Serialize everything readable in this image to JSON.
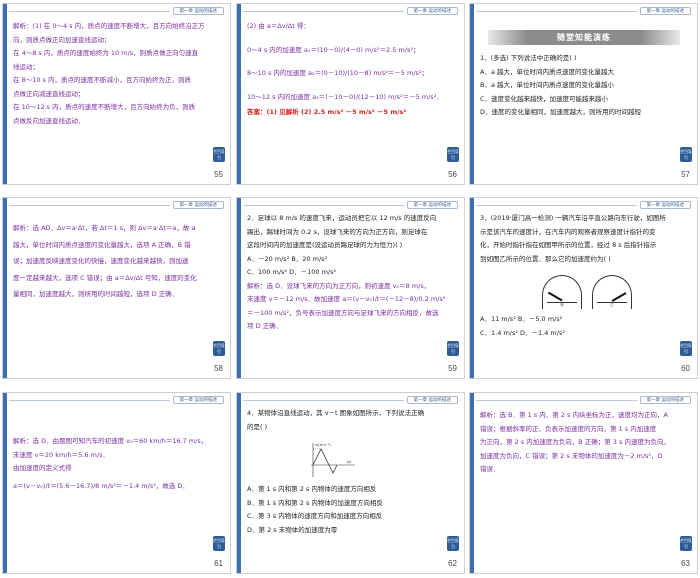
{
  "header_label": "第一章  运动的描述",
  "back_label": "栏目导引",
  "slides": [
    {
      "page": "55",
      "lines": [
        "解析：(1) 在 0～4 s 内，质点的速度不断增大，且方向始终沿正方",
        "向，则质点做正向加速直线运动；",
        "在 4～8 s 内，质点的速度始终为 10 m/s，则质点做正向匀速直",
        "线运动；",
        "在 8～10 s 内，质点的速度不断减小，且方向始终为正，则质",
        "点做正向减速直线运动；",
        "在 10～12 s 内，质点的速度不断增大，且方向始终为负，则质",
        "点做反向加速直线运动．"
      ]
    },
    {
      "page": "56",
      "lines": [
        "(2) 由 a＝Δv/Δt 得：",
        "0～4 s 内的加速度 a₁＝(10－0)/(4－0) m/s²＝2.5 m/s²；",
        "8～10 s 内的加速度 a₂＝(0－10)/(10－8) m/s²＝－5 m/s²；",
        "10～12 s 内的加速度 a₃＝(－10－0)/(12－10) m/s²＝－5 m/s²．",
        "答案：(1) 见解析  (2) 2.5 m/s²   －5 m/s²   －5 m/s²"
      ]
    },
    {
      "page": "57",
      "banner": "随堂知能演练",
      "lines": [
        "1．(多选) 下列说法中正确的是(    )",
        "A．a 越大，单位时间内质点速度的变化量越大",
        "B．a 越大，单位时间内质点速度的变化量越小",
        "C．速度变化越来越快，加速度可能越来越小",
        "D．速度的变化量相同，加速度越大，则所用的时间越短"
      ]
    },
    {
      "page": "58",
      "lines": [
        "解析：选 AD．Δv＝a·Δt，若 Δt＝1 s，则 Δv＝a·Δt＝a，故 a",
        "越大，单位时间内质点速度的变化量越大，选项 A 正确，B 错",
        "误；加速度反映速度变化的快慢，速度变化越来越快，则加速",
        "度一定越来越大，选项 C 错误；由 a＝Δv/Δt 可知，速度的变化",
        "量相同，加速度越大，则所用的时间越短，选项 D 正确．"
      ]
    },
    {
      "page": "59",
      "lines": [
        "2．足球以 8 m/s 的速度飞来，运动员把它以 12 m/s 的速度反向",
        "踢出，踢球时间为 0.2 s，设球飞来的方向为正方向，则足球在",
        "这段时间内的加速度是(设运动员踢足球的力为恒力)(    )",
        "A．－20 m/s²                 B．20 m/s²",
        "C．100 m/s²                  D．－100 m/s²",
        "解析：选 D．设球飞来的方向为正方向，则初速度 v₀＝8 m/s，",
        "末速度 v＝－12 m/s．故加速度 a＝(v－v₀)/t＝(－12－8)/0.2 m/s²",
        "＝－100 m/s²，负号表示加速度方向与足球飞来的方向相反，故选",
        "项 D 正确．"
      ]
    },
    {
      "page": "60",
      "lines": [
        "3．(2019·厦门高一检测) 一辆汽车沿平直公路向东行驶，如图所",
        "示是该汽车的速度计，在汽车内的观察者观察速度计指针的变",
        "化，开始时指针指在如图甲所示的位置，经过 8 s 后指针指示",
        "到如图乙所示的位置．那么它的加速度约为(    )"
      ],
      "gauge_labels": [
        "甲",
        "乙"
      ],
      "options": [
        "A．11 m/s²                    B．－5.0 m/s²",
        "C．1.4 m/s²                   D．－1.4 m/s²"
      ]
    },
    {
      "page": "61",
      "lines": [
        "解析：选 D．由题图可知汽车的初速度 v₀＝60 km/h＝16.7 m/s，",
        "末速度 v＝20 km/h＝5.6 m/s．",
        "由加速度的定义式得",
        "a＝(v－v₀)/t＝(5.6－16.7)/8 m/s²＝－1.4 m/s²，故选 D．"
      ]
    },
    {
      "page": "62",
      "lines": [
        "4．某物体沿直线运动，其 v－t 图象如图所示，下列说法正确",
        "的是(    )"
      ],
      "graph_labels": {
        "y": "v/(m·s⁻¹)",
        "x": "t/s"
      },
      "options": [
        "A．第 1 s 内和第 2 s 内物体的速度方向相反",
        "B．第 1 s 内和第 2 s 内物体的加速度方向相反",
        "C．第 3 s 内物体的速度方向和加速度方向相反",
        "D．第 2 s 末物体的加速度为零"
      ]
    },
    {
      "page": "63",
      "lines": [
        "解析：选 B．第 1 s 内、第 2 s 内纵坐标为正，速度均为正向，A",
        "错误；根据斜率的正、负表示加速度的方向，第 1 s 内加速度",
        "为正向，第 2 s 内加速度为负向，B 正确；第 3 s 内速度为负向，",
        "加速度为负向，C 错误；第 2 s 末物体的加速度为－2 m/s²，D",
        "错误．"
      ]
    }
  ]
}
